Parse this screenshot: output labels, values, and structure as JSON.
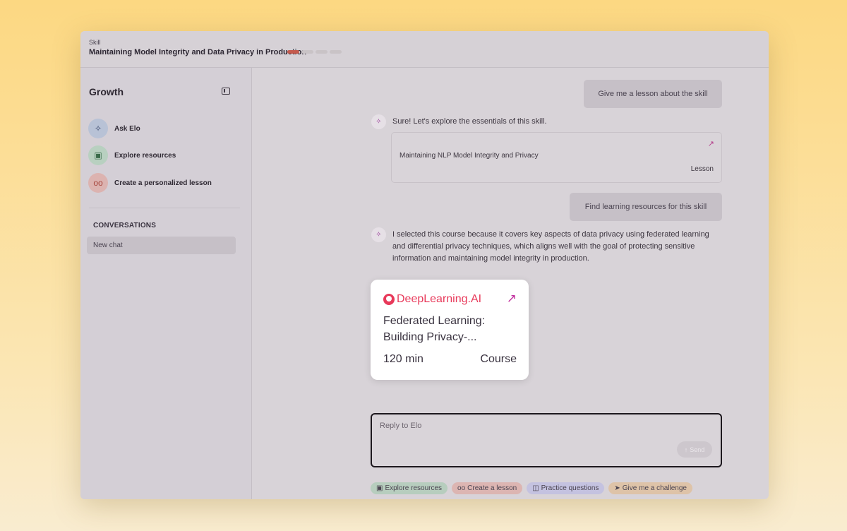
{
  "topbar": {
    "kicker": "Skill",
    "title": "Maintaining Model Integrity and Data Privacy in Production",
    "progress": {
      "completed_steps": 1,
      "total_steps": 4,
      "active_color": "#c45a4e"
    }
  },
  "sidebar": {
    "brand": "Growth",
    "items": [
      {
        "label": "Ask Elo",
        "icon": "sparkle-icon",
        "color": "#b8c2d6"
      },
      {
        "label": "Explore resources",
        "icon": "book-icon",
        "color": "#b8d0c0"
      },
      {
        "label": "Create a personalized lesson",
        "icon": "glasses-icon",
        "color": "#dcb3b0"
      }
    ],
    "conversations_heading": "CONVERSATIONS",
    "conversations": [
      "New chat"
    ]
  },
  "chat": {
    "messages": [
      {
        "role": "user",
        "text": "Give me a lesson about the skill"
      },
      {
        "role": "assistant",
        "text": "Sure! Let's explore the essentials of this skill."
      },
      {
        "role": "user",
        "text": "Find learning resources for this skill"
      },
      {
        "role": "assistant",
        "text": "I selected this course because it covers key aspects of data privacy using federated learning and differential privacy techniques, which aligns well with the goal of protecting sensitive information and maintaining model integrity in production."
      }
    ],
    "lesson_card": {
      "title": "Maintaining NLP Model Integrity and Privacy",
      "type": "Lesson"
    },
    "course_card": {
      "provider": "DeepLearning.AI",
      "title": "Federated Learning: Building Privacy-...",
      "duration": "120 min",
      "type": "Course",
      "brand_color": "#e8395a"
    }
  },
  "composer": {
    "placeholder": "Reply to Elo",
    "send_label": "Send"
  },
  "chips": [
    {
      "label": "Explore resources",
      "icon": "book-icon",
      "color": "#b7cdbe"
    },
    {
      "label": "Create a lesson",
      "icon": "glasses-icon",
      "color": "#dcb5b2"
    },
    {
      "label": "Practice questions",
      "icon": "chat-bubbles-icon",
      "color": "#c4c2e0"
    },
    {
      "label": "Give me a challenge",
      "icon": "send-plane-icon",
      "color": "#dec3a8"
    }
  ]
}
